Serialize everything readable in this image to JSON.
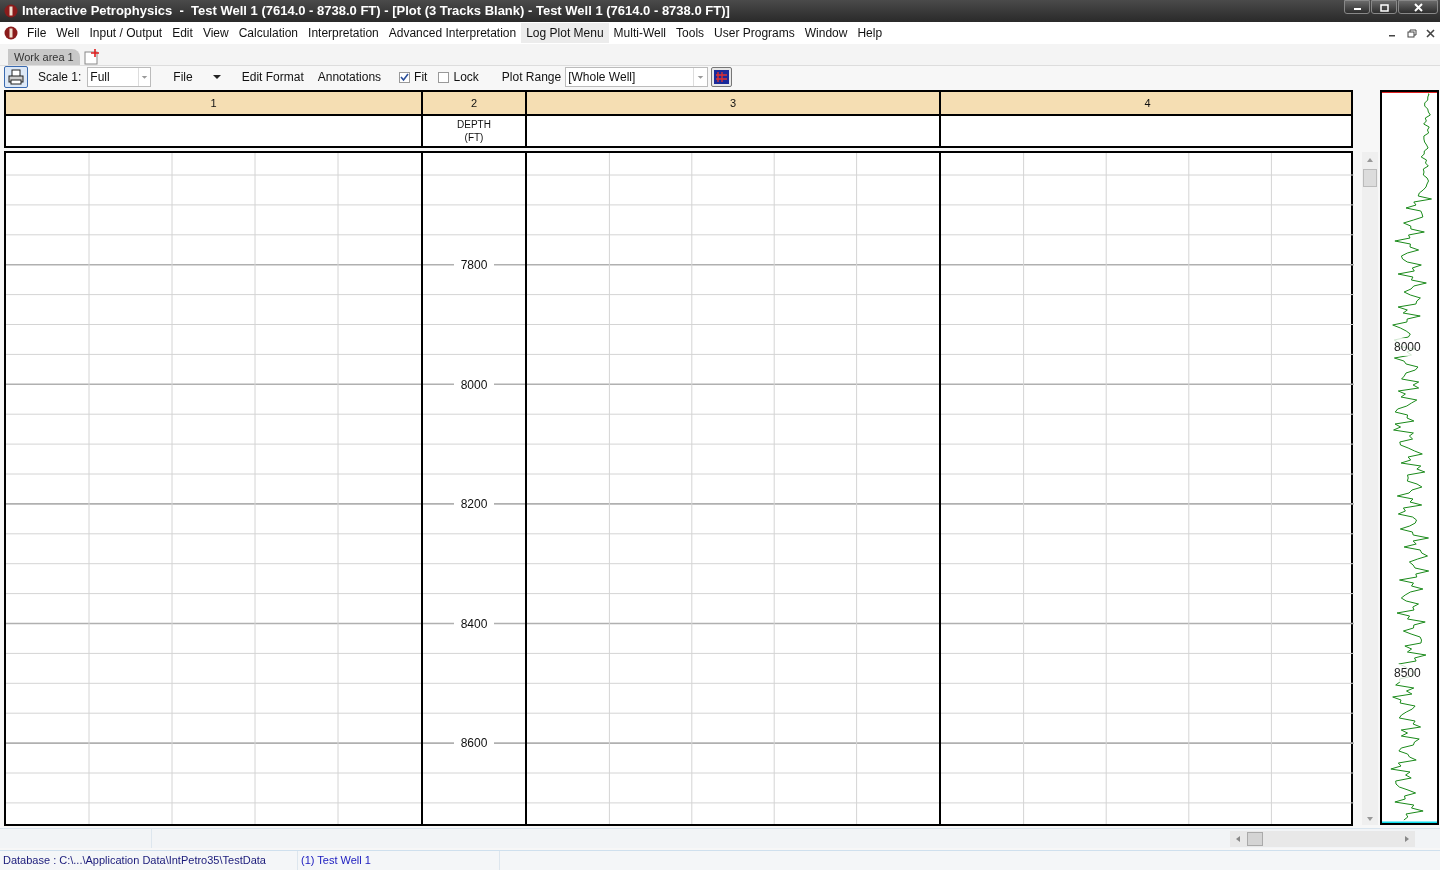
{
  "window": {
    "title": "Interactive Petrophysics  -  Test Well 1 (7614.0 - 8738.0 FT) - [Plot (3 Tracks Blank) - Test Well 1 (7614.0 - 8738.0 FT)]"
  },
  "menu": [
    {
      "label": "File",
      "selected": false
    },
    {
      "label": "Well",
      "selected": false
    },
    {
      "label": "Input / Output",
      "selected": false
    },
    {
      "label": "Edit",
      "selected": false
    },
    {
      "label": "View",
      "selected": false
    },
    {
      "label": "Calculation",
      "selected": false
    },
    {
      "label": "Interpretation",
      "selected": false
    },
    {
      "label": "Advanced Interpretation",
      "selected": false
    },
    {
      "label": "Log Plot Menu",
      "selected": true
    },
    {
      "label": "Multi-Well",
      "selected": false
    },
    {
      "label": "Tools",
      "selected": false
    },
    {
      "label": "User Programs",
      "selected": false
    },
    {
      "label": "Window",
      "selected": false
    },
    {
      "label": "Help",
      "selected": false
    }
  ],
  "tabs": [
    {
      "label": "Work area 1",
      "selected": true
    }
  ],
  "toolbar": {
    "scale_label": "Scale 1:",
    "scale_value": "Full",
    "file_menu": "File",
    "edit_format": "Edit Format",
    "annotations": "Annotations",
    "fit": {
      "label": "Fit",
      "checked": true
    },
    "lock": {
      "label": "Lock",
      "checked": false
    },
    "plot_range_label": "Plot Range",
    "plot_range_value": "[Whole Well]"
  },
  "tracks": [
    {
      "number": "1",
      "kind": "grid"
    },
    {
      "number": "2",
      "kind": "depth",
      "header": [
        "DEPTH",
        "(FT)"
      ],
      "depth_labels": [
        "7800",
        "8000",
        "8200",
        "8400",
        "8600"
      ]
    },
    {
      "number": "3",
      "kind": "grid"
    },
    {
      "number": "4",
      "kind": "grid"
    }
  ],
  "overview": {
    "depth_labels": [
      "8000",
      "8500"
    ]
  },
  "status_bar": [
    "Database : C:\\...\\Application Data\\IntPetro35\\TestData",
    "(1) Test Well 1"
  ]
}
